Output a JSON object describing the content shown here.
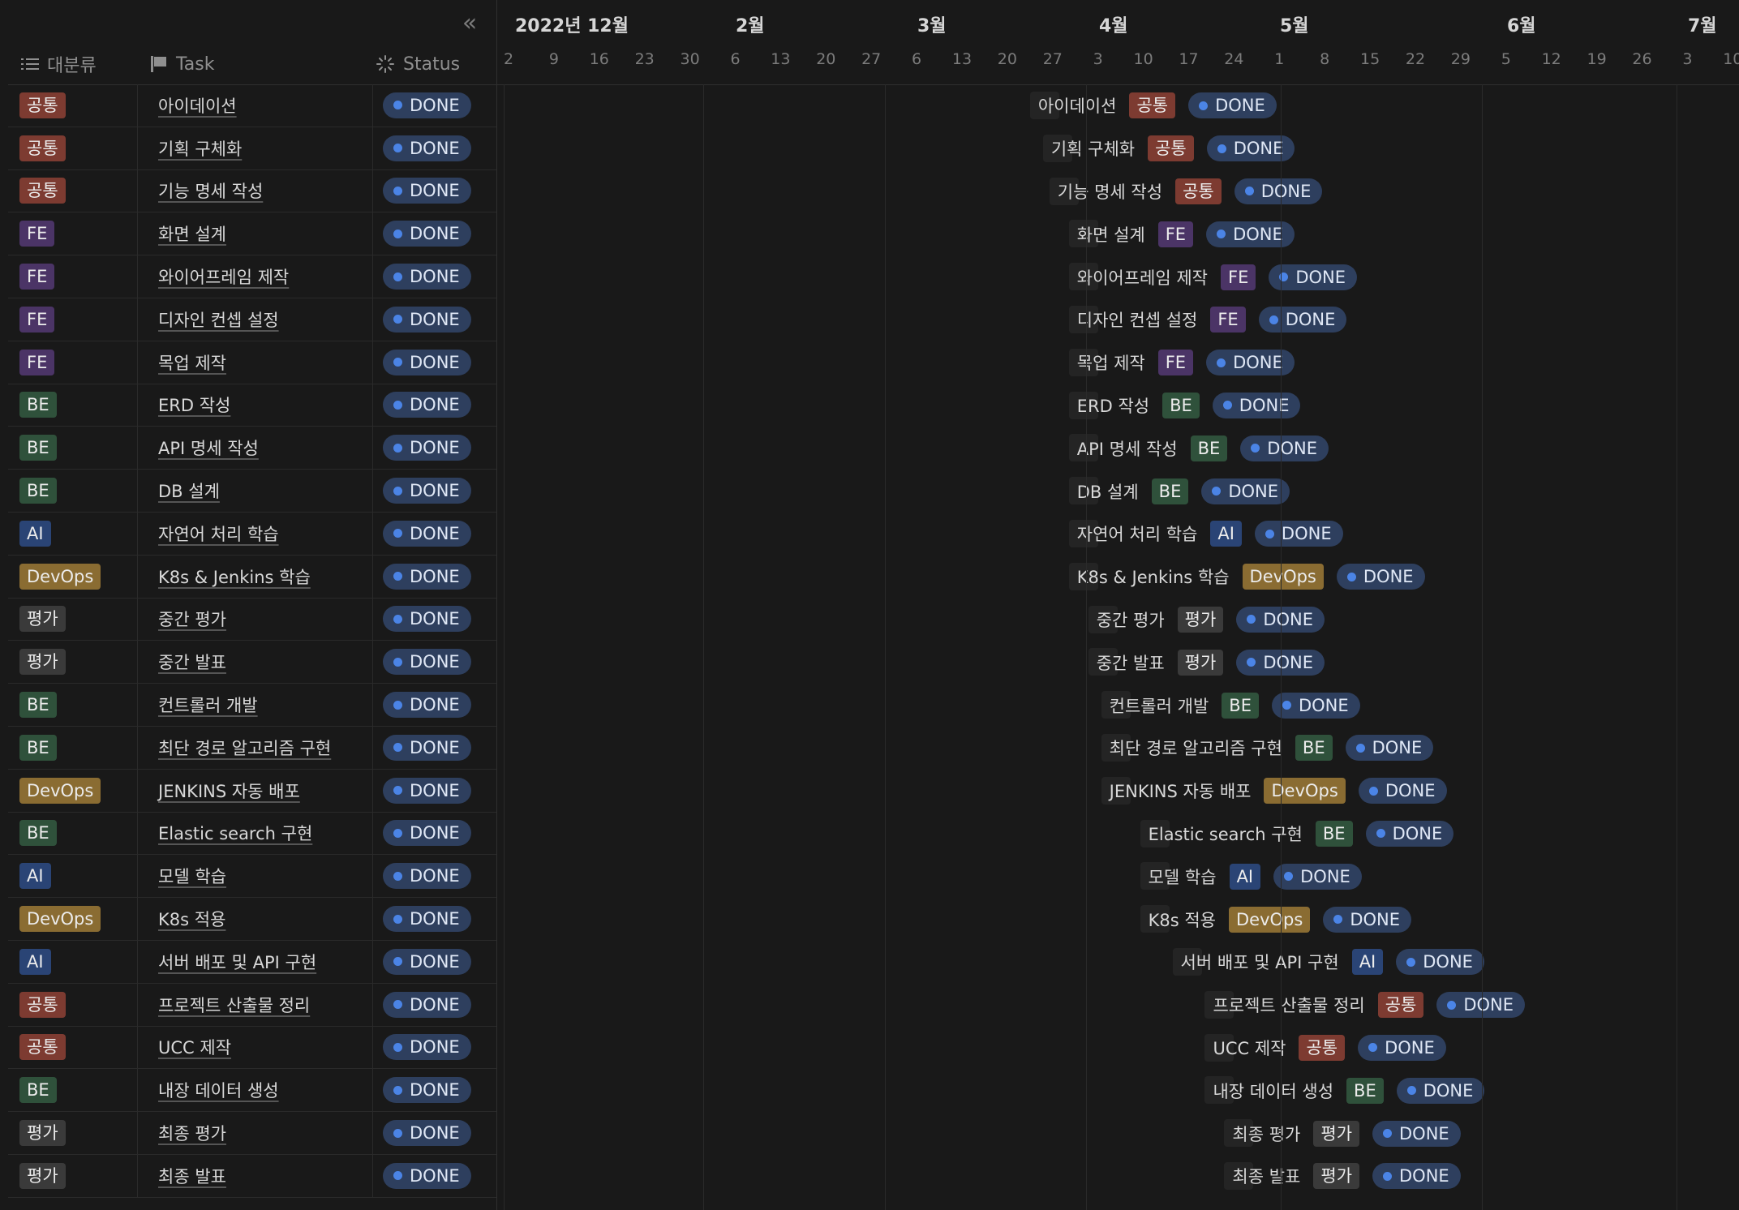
{
  "toolbar": {
    "collapse_icon": "double-chevron-left-icon",
    "collapse_glyph": "«"
  },
  "columns": {
    "category": "대분류",
    "task": "Task",
    "status": "Status"
  },
  "timeline": {
    "months": [
      "2022년 12월",
      "2월",
      "3월",
      "4월",
      "5월",
      "6월",
      "7월"
    ],
    "days": [
      "2",
      "9",
      "16",
      "23",
      "30",
      "6",
      "13",
      "20",
      "27",
      "6",
      "13",
      "20",
      "27",
      "3",
      "10",
      "17",
      "24",
      "1",
      "8",
      "15",
      "22",
      "29",
      "5",
      "12",
      "19",
      "26",
      "3",
      "10"
    ]
  },
  "categories": {
    "common": {
      "label": "공통",
      "color": "#7d3b31"
    },
    "fe": {
      "label": "FE",
      "color": "#4b3466"
    },
    "be": {
      "label": "BE",
      "color": "#2f513b"
    },
    "ai": {
      "label": "AI",
      "color": "#2a4475"
    },
    "devops": {
      "label": "DevOps",
      "color": "#8a6c32"
    },
    "eval": {
      "label": "평가",
      "color": "#3a3a3a"
    }
  },
  "status_color": "#4b84e6",
  "tasks": [
    {
      "category": "공통",
      "cat": "common",
      "task": "아이데이션",
      "status": "DONE"
    },
    {
      "category": "공통",
      "cat": "common",
      "task": "기획 구체화",
      "status": "DONE"
    },
    {
      "category": "공통",
      "cat": "common",
      "task": "기능 명세 작성",
      "status": "DONE"
    },
    {
      "category": "FE",
      "cat": "fe",
      "task": "화면 설계",
      "status": "DONE"
    },
    {
      "category": "FE",
      "cat": "fe",
      "task": "와이어프레임 제작",
      "status": "DONE"
    },
    {
      "category": "FE",
      "cat": "fe",
      "task": "디자인 컨셉 설정",
      "status": "DONE"
    },
    {
      "category": "FE",
      "cat": "fe",
      "task": "목업 제작",
      "status": "DONE"
    },
    {
      "category": "BE",
      "cat": "be",
      "task": "ERD 작성",
      "status": "DONE"
    },
    {
      "category": "BE",
      "cat": "be",
      "task": "API 명세 작성",
      "status": "DONE"
    },
    {
      "category": "BE",
      "cat": "be",
      "task": "DB 설계",
      "status": "DONE"
    },
    {
      "category": "AI",
      "cat": "ai",
      "task": "자연어 처리 학습",
      "status": "DONE"
    },
    {
      "category": "DevOps",
      "cat": "devops",
      "task": "K8s & Jenkins 학습",
      "status": "DONE"
    },
    {
      "category": "평가",
      "cat": "eval",
      "task": "중간 평가",
      "status": "DONE"
    },
    {
      "category": "평가",
      "cat": "eval",
      "task": "중간 발표",
      "status": "DONE"
    },
    {
      "category": "BE",
      "cat": "be",
      "task": "컨트롤러 개발",
      "status": "DONE"
    },
    {
      "category": "BE",
      "cat": "be",
      "task": "최단 경로 알고리즘 구현",
      "status": "DONE"
    },
    {
      "category": "DevOps",
      "cat": "devops",
      "task": "JENKINS 자동 배포",
      "status": "DONE"
    },
    {
      "category": "BE",
      "cat": "be",
      "task": "Elastic search 구현",
      "status": "DONE"
    },
    {
      "category": "AI",
      "cat": "ai",
      "task": "모델 학습",
      "status": "DONE"
    },
    {
      "category": "DevOps",
      "cat": "devops",
      "task": "K8s 적용",
      "status": "DONE"
    },
    {
      "category": "AI",
      "cat": "ai",
      "task": "서버 배포 및 API 구현",
      "status": "DONE"
    },
    {
      "category": "공통",
      "cat": "common",
      "task": "프로젝트 산출물 정리",
      "status": "DONE"
    },
    {
      "category": "공통",
      "cat": "common",
      "task": "UCC 제작",
      "status": "DONE"
    },
    {
      "category": "BE",
      "cat": "be",
      "task": "내장 데이터 생성",
      "status": "DONE"
    },
    {
      "category": "평가",
      "cat": "eval",
      "task": "최종 평가",
      "status": "DONE"
    },
    {
      "category": "평가",
      "cat": "eval",
      "task": "최종 발표",
      "status": "DONE"
    }
  ]
}
